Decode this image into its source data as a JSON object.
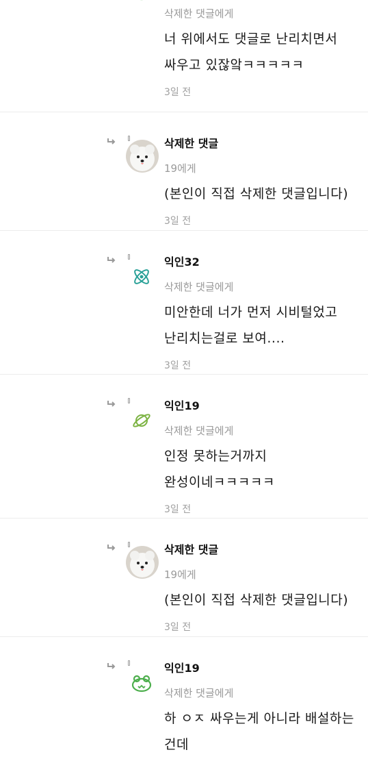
{
  "comments": [
    {
      "author": "",
      "target": "삭제한 댓글에게",
      "body": "너 위에서도 댓글로 난리치면서 싸우고 있잖앜ㅋㅋㅋㅋㅋ",
      "time": "3일 전",
      "avatar_icon": "frog-green-icon"
    },
    {
      "author": "삭제한 댓글",
      "target": "19에게",
      "body": "(본인이 직접 삭제한 댓글입니다)",
      "time": "3일 전",
      "avatar_icon": "white-dog-photo"
    },
    {
      "author": "익인32",
      "target": "삭제한 댓글에게",
      "body": "미안한데 너가 먼저 시비털었고 난리치는걸로 보여....",
      "time": "3일 전",
      "avatar_icon": "atom-teal-icon"
    },
    {
      "author": "익인19",
      "target": "삭제한 댓글에게",
      "body": "인정 못하는거까지 완성이네ㅋㅋㅋㅋㅋ",
      "time": "3일 전",
      "avatar_icon": "planet-green-icon"
    },
    {
      "author": "삭제한 댓글",
      "target": "19에게",
      "body": "(본인이 직접 삭제한 댓글입니다)",
      "time": "3일 전",
      "avatar_icon": "white-dog-photo"
    },
    {
      "author": "익인19",
      "target": "삭제한 댓글에게",
      "body": "하 ㅇㅈ 싸우는게 아니라 배설하는 건데",
      "time": "",
      "avatar_icon": "frog-green-icon"
    }
  ],
  "colors": {
    "frog": "#4cae4c",
    "atom": "#2aa198",
    "planet": "#7cb342",
    "muted_text": "#9a9a9a"
  }
}
